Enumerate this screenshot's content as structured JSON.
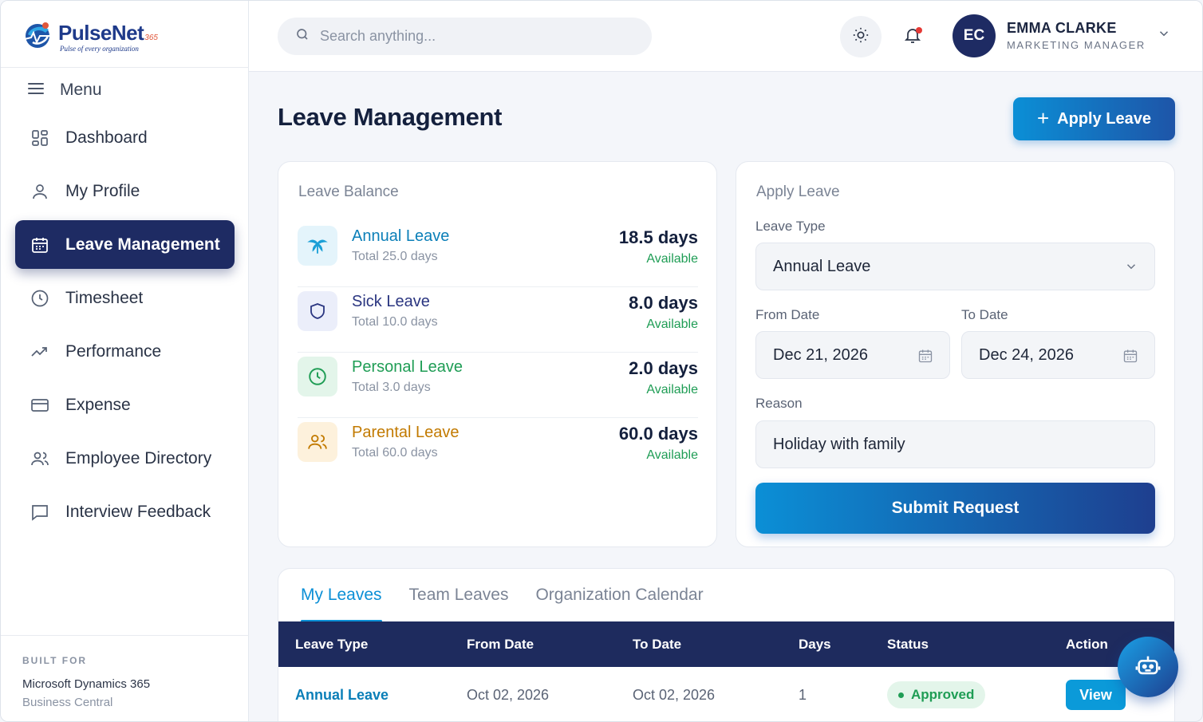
{
  "brand": {
    "name": "PulseNet",
    "superscript": "365",
    "tagline": "Pulse of every organization"
  },
  "sidebar": {
    "menu_label": "Menu",
    "items": [
      {
        "label": "Dashboard",
        "icon": "dashboard-icon"
      },
      {
        "label": "My Profile",
        "icon": "user-icon"
      },
      {
        "label": "Leave Management",
        "icon": "calendar-icon",
        "active": true
      },
      {
        "label": "Timesheet",
        "icon": "clock-icon"
      },
      {
        "label": "Performance",
        "icon": "trending-up-icon"
      },
      {
        "label": "Expense",
        "icon": "credit-card-icon"
      },
      {
        "label": "Employee Directory",
        "icon": "users-icon"
      },
      {
        "label": "Interview Feedback",
        "icon": "message-square-icon"
      }
    ],
    "built_for": {
      "label": "BUILT FOR",
      "line1": "Microsoft Dynamics 365",
      "line2": "Business Central"
    }
  },
  "header": {
    "search_placeholder": "Search anything...",
    "user": {
      "initials": "EC",
      "name": "EMMA CLARKE",
      "role": "MARKETING MANAGER"
    }
  },
  "page": {
    "title": "Leave Management",
    "apply_button": "Apply Leave"
  },
  "balance": {
    "title": "Leave Balance",
    "items": [
      {
        "name": "Annual Leave",
        "total": "Total 25.0 days",
        "days": "18.5 days",
        "status": "Available",
        "color": "#0b7fb8",
        "bg": "#e4f4fb",
        "icon": "palm-tree-icon"
      },
      {
        "name": "Sick Leave",
        "total": "Total 10.0 days",
        "days": "8.0 days",
        "status": "Available",
        "color": "#2a3580",
        "bg": "#ebeefa",
        "icon": "shield-icon"
      },
      {
        "name": "Personal Leave",
        "total": "Total 3.0 days",
        "days": "2.0 days",
        "status": "Available",
        "color": "#1f9d55",
        "bg": "#e3f5ea",
        "icon": "clock-icon"
      },
      {
        "name": "Parental Leave",
        "total": "Total 60.0 days",
        "days": "60.0 days",
        "status": "Available",
        "color": "#c27a00",
        "bg": "#fdf1dc",
        "icon": "users-icon"
      }
    ]
  },
  "apply_form": {
    "title": "Apply Leave",
    "leave_type_label": "Leave Type",
    "leave_type_value": "Annual Leave",
    "from_label": "From Date",
    "from_value": "Dec 21, 2026",
    "to_label": "To Date",
    "to_value": "Dec 24, 2026",
    "reason_label": "Reason",
    "reason_value": "Holiday with family",
    "submit_label": "Submit Request"
  },
  "leaves_table": {
    "tabs": [
      "My Leaves",
      "Team Leaves",
      "Organization Calendar"
    ],
    "columns": [
      "Leave Type",
      "From Date",
      "To Date",
      "Days",
      "Status",
      "Action"
    ],
    "rows": [
      {
        "type": "Annual Leave",
        "from": "Oct 02, 2026",
        "to": "Oct 02, 2026",
        "days": "1",
        "status": "Approved",
        "action": "View"
      }
    ]
  }
}
